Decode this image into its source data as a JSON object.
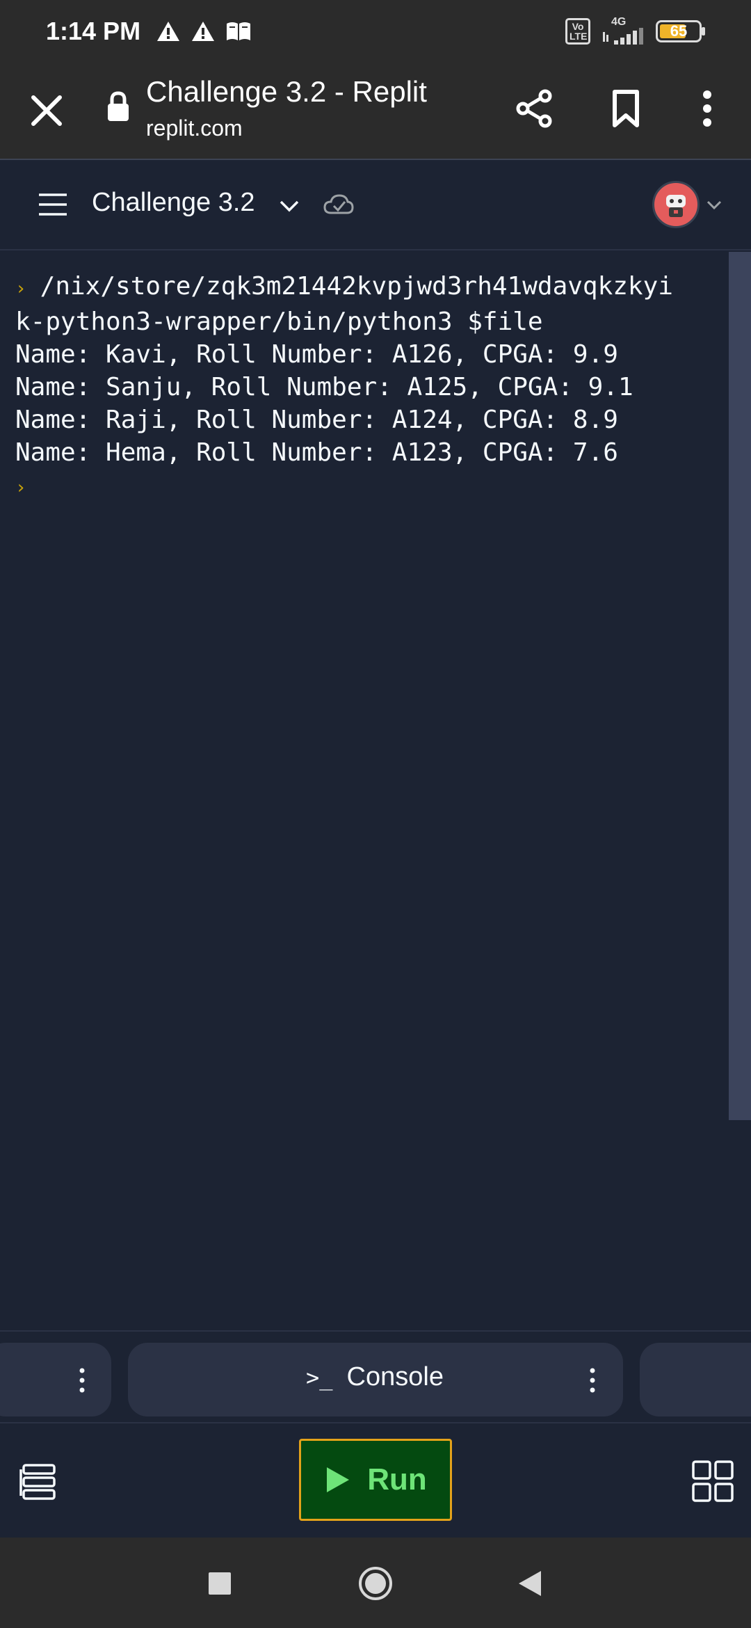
{
  "status_bar": {
    "time": "1:14 PM",
    "network": "4G",
    "volte": "Vo LTE",
    "battery": "65",
    "icons": [
      "warning-icon",
      "warning-icon",
      "book-icon",
      "signal-icon",
      "battery-icon"
    ]
  },
  "browser": {
    "title": "Challenge 3.2 - Replit",
    "url": "replit.com",
    "icons": [
      "close-icon",
      "lock-icon",
      "share-icon",
      "bookmark-icon",
      "more-vertical-icon"
    ]
  },
  "app_header": {
    "project_name": "Challenge 3.2",
    "icons": [
      "menu-icon",
      "chevron-down-icon",
      "cloud-check-icon",
      "avatar",
      "chevron-down-icon"
    ]
  },
  "console": {
    "command_line_1": "/nix/store/zqk3m21442kvpjwd3rh41wdavqkzkyi",
    "command_line_2": "k-python3-wrapper/bin/python3 $file",
    "output": [
      "Name: Kavi, Roll Number: A126, CPGA: 9.9",
      "Name: Sanju, Roll Number: A125, CPGA: 9.1",
      "Name: Raji, Roll Number: A124, CPGA: 8.9",
      "Name: Hema, Roll Number: A123, CPGA: 7.6"
    ]
  },
  "panes": {
    "console_label": "Console",
    "console_icon": ">_"
  },
  "toolbar": {
    "run_label": "Run",
    "accent_color": "#e3a21a",
    "run_bg": "#044a10",
    "run_text_color": "#6ee478"
  },
  "colors": {
    "background": "#1c2333",
    "surface": "#2b3245",
    "prompt": "#c9a30a"
  }
}
